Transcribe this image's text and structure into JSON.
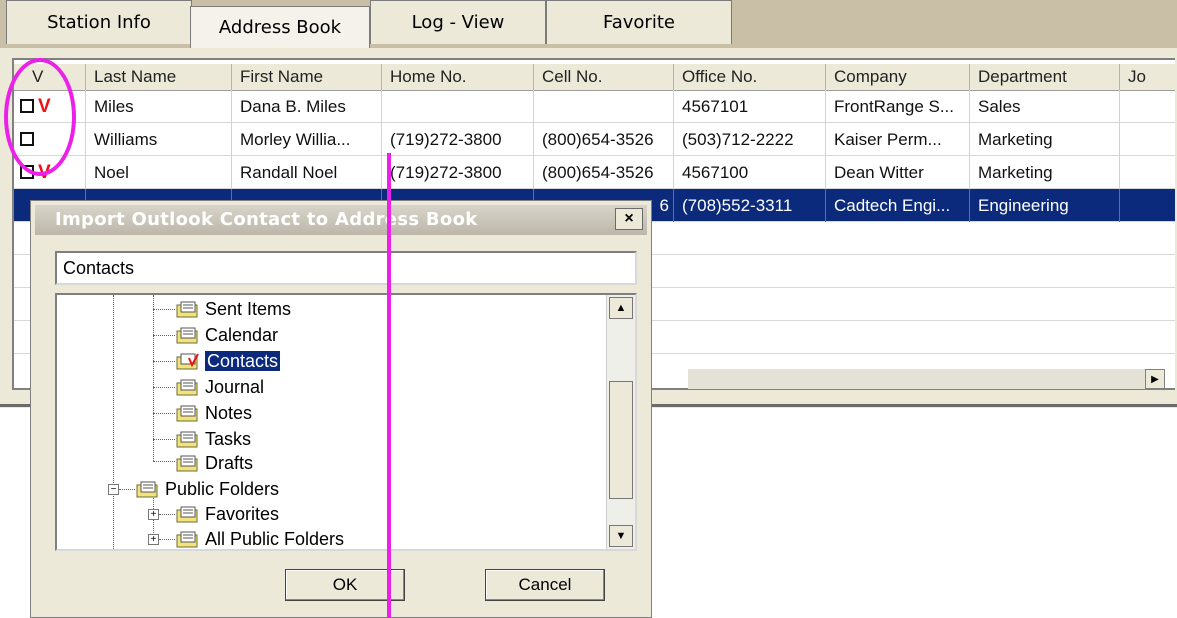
{
  "tabs": [
    {
      "label": "Station Info"
    },
    {
      "label": "Address Book"
    },
    {
      "label": "Log - View"
    },
    {
      "label": "Favorite"
    }
  ],
  "table": {
    "columns": [
      "V",
      "Last Name",
      "First Name",
      "Home No.",
      "Cell No.",
      "Office No.",
      "Company",
      "Department",
      "Jo"
    ],
    "rows": [
      {
        "checked_mark": "V",
        "last": "Miles",
        "first": "Dana B. Miles",
        "home": "",
        "cell": "",
        "office": "4567101",
        "company": "FrontRange S...",
        "dept": "Sales"
      },
      {
        "checked_mark": "",
        "last": "Williams",
        "first": "Morley Willia...",
        "home": "(719)272-3800",
        "cell": "(800)654-3526",
        "office": "(503)712-2222",
        "company": "Kaiser Perm...",
        "dept": "Marketing"
      },
      {
        "checked_mark": "V",
        "last": "Noel",
        "first": "Randall Noel",
        "home": "(719)272-3800",
        "cell": "(800)654-3526",
        "office": "4567100",
        "company": "Dean Witter",
        "dept": "Marketing"
      },
      {
        "checked_mark": "",
        "last": "",
        "first": "",
        "home": "",
        "cell": "",
        "office": "(708)552-3311",
        "company": "Cadtech Engi...",
        "dept": "Engineering",
        "partial_cell": "6"
      }
    ]
  },
  "dialog": {
    "title": "Import Outlook Contact to Address Book",
    "close_label": "×",
    "folder_input": "Contacts",
    "tree": [
      {
        "label": "Sent Items"
      },
      {
        "label": "Calendar"
      },
      {
        "label": "Contacts"
      },
      {
        "label": "Journal"
      },
      {
        "label": "Notes"
      },
      {
        "label": "Tasks"
      },
      {
        "label": "Drafts"
      },
      {
        "label": "Public Folders"
      },
      {
        "label": "Favorites"
      },
      {
        "label": "All Public Folders"
      }
    ],
    "ok_label": "OK",
    "cancel_label": "Cancel"
  },
  "colors": {
    "annotation": "#ec21e9",
    "selection": "#0c2a7c",
    "check_mark": "#e11111"
  },
  "icons": [
    "folder-icon",
    "contacts-folder-icon",
    "scroll-up-icon",
    "scroll-down-icon",
    "scroll-right-icon",
    "close-icon",
    "expand-icon",
    "collapse-icon"
  ]
}
